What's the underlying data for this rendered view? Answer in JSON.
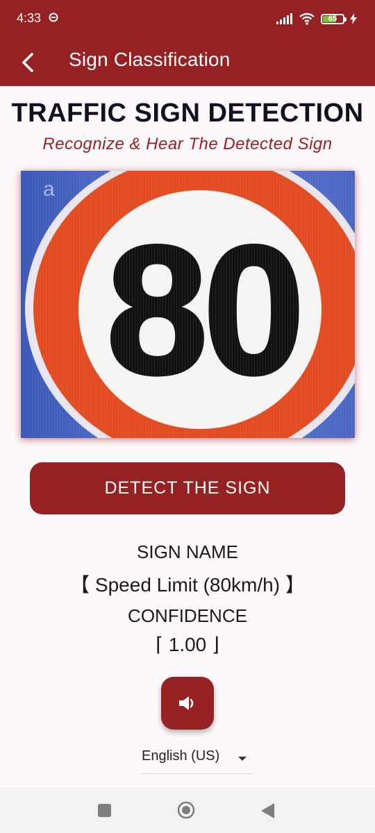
{
  "status_bar": {
    "time": "4:33",
    "battery_level": "65",
    "battery_fraction": 0.65,
    "icons": [
      "clock-icon",
      "signal-icon",
      "wifi-icon",
      "battery-icon",
      "charging-icon"
    ]
  },
  "app_bar": {
    "title": "Sign Classification",
    "back_icon": "back-arrow-icon",
    "background_color": "#962122"
  },
  "header": {
    "title": "TRAFFIC SIGN DETECTION",
    "subtitle": "Recognize & Hear The Detected Sign"
  },
  "image": {
    "sign_number": "80",
    "watermark_letter": "a"
  },
  "detect_button": {
    "label": "DETECT THE SIGN"
  },
  "result": {
    "sign_name_label": "SIGN NAME",
    "sign_name_value": "【 Speed Limit (80km/h) 】",
    "confidence_label": "CONFIDENCE",
    "confidence_value": "⌈ 1.00 ⌋"
  },
  "speak_button": {
    "icon": "speaker-icon"
  },
  "language": {
    "selected": "English (US)"
  },
  "nav_bar": {
    "icons": [
      "recents-icon",
      "home-icon",
      "back-icon"
    ]
  },
  "colors": {
    "accent": "#962122",
    "background": "#fdf8fb"
  }
}
